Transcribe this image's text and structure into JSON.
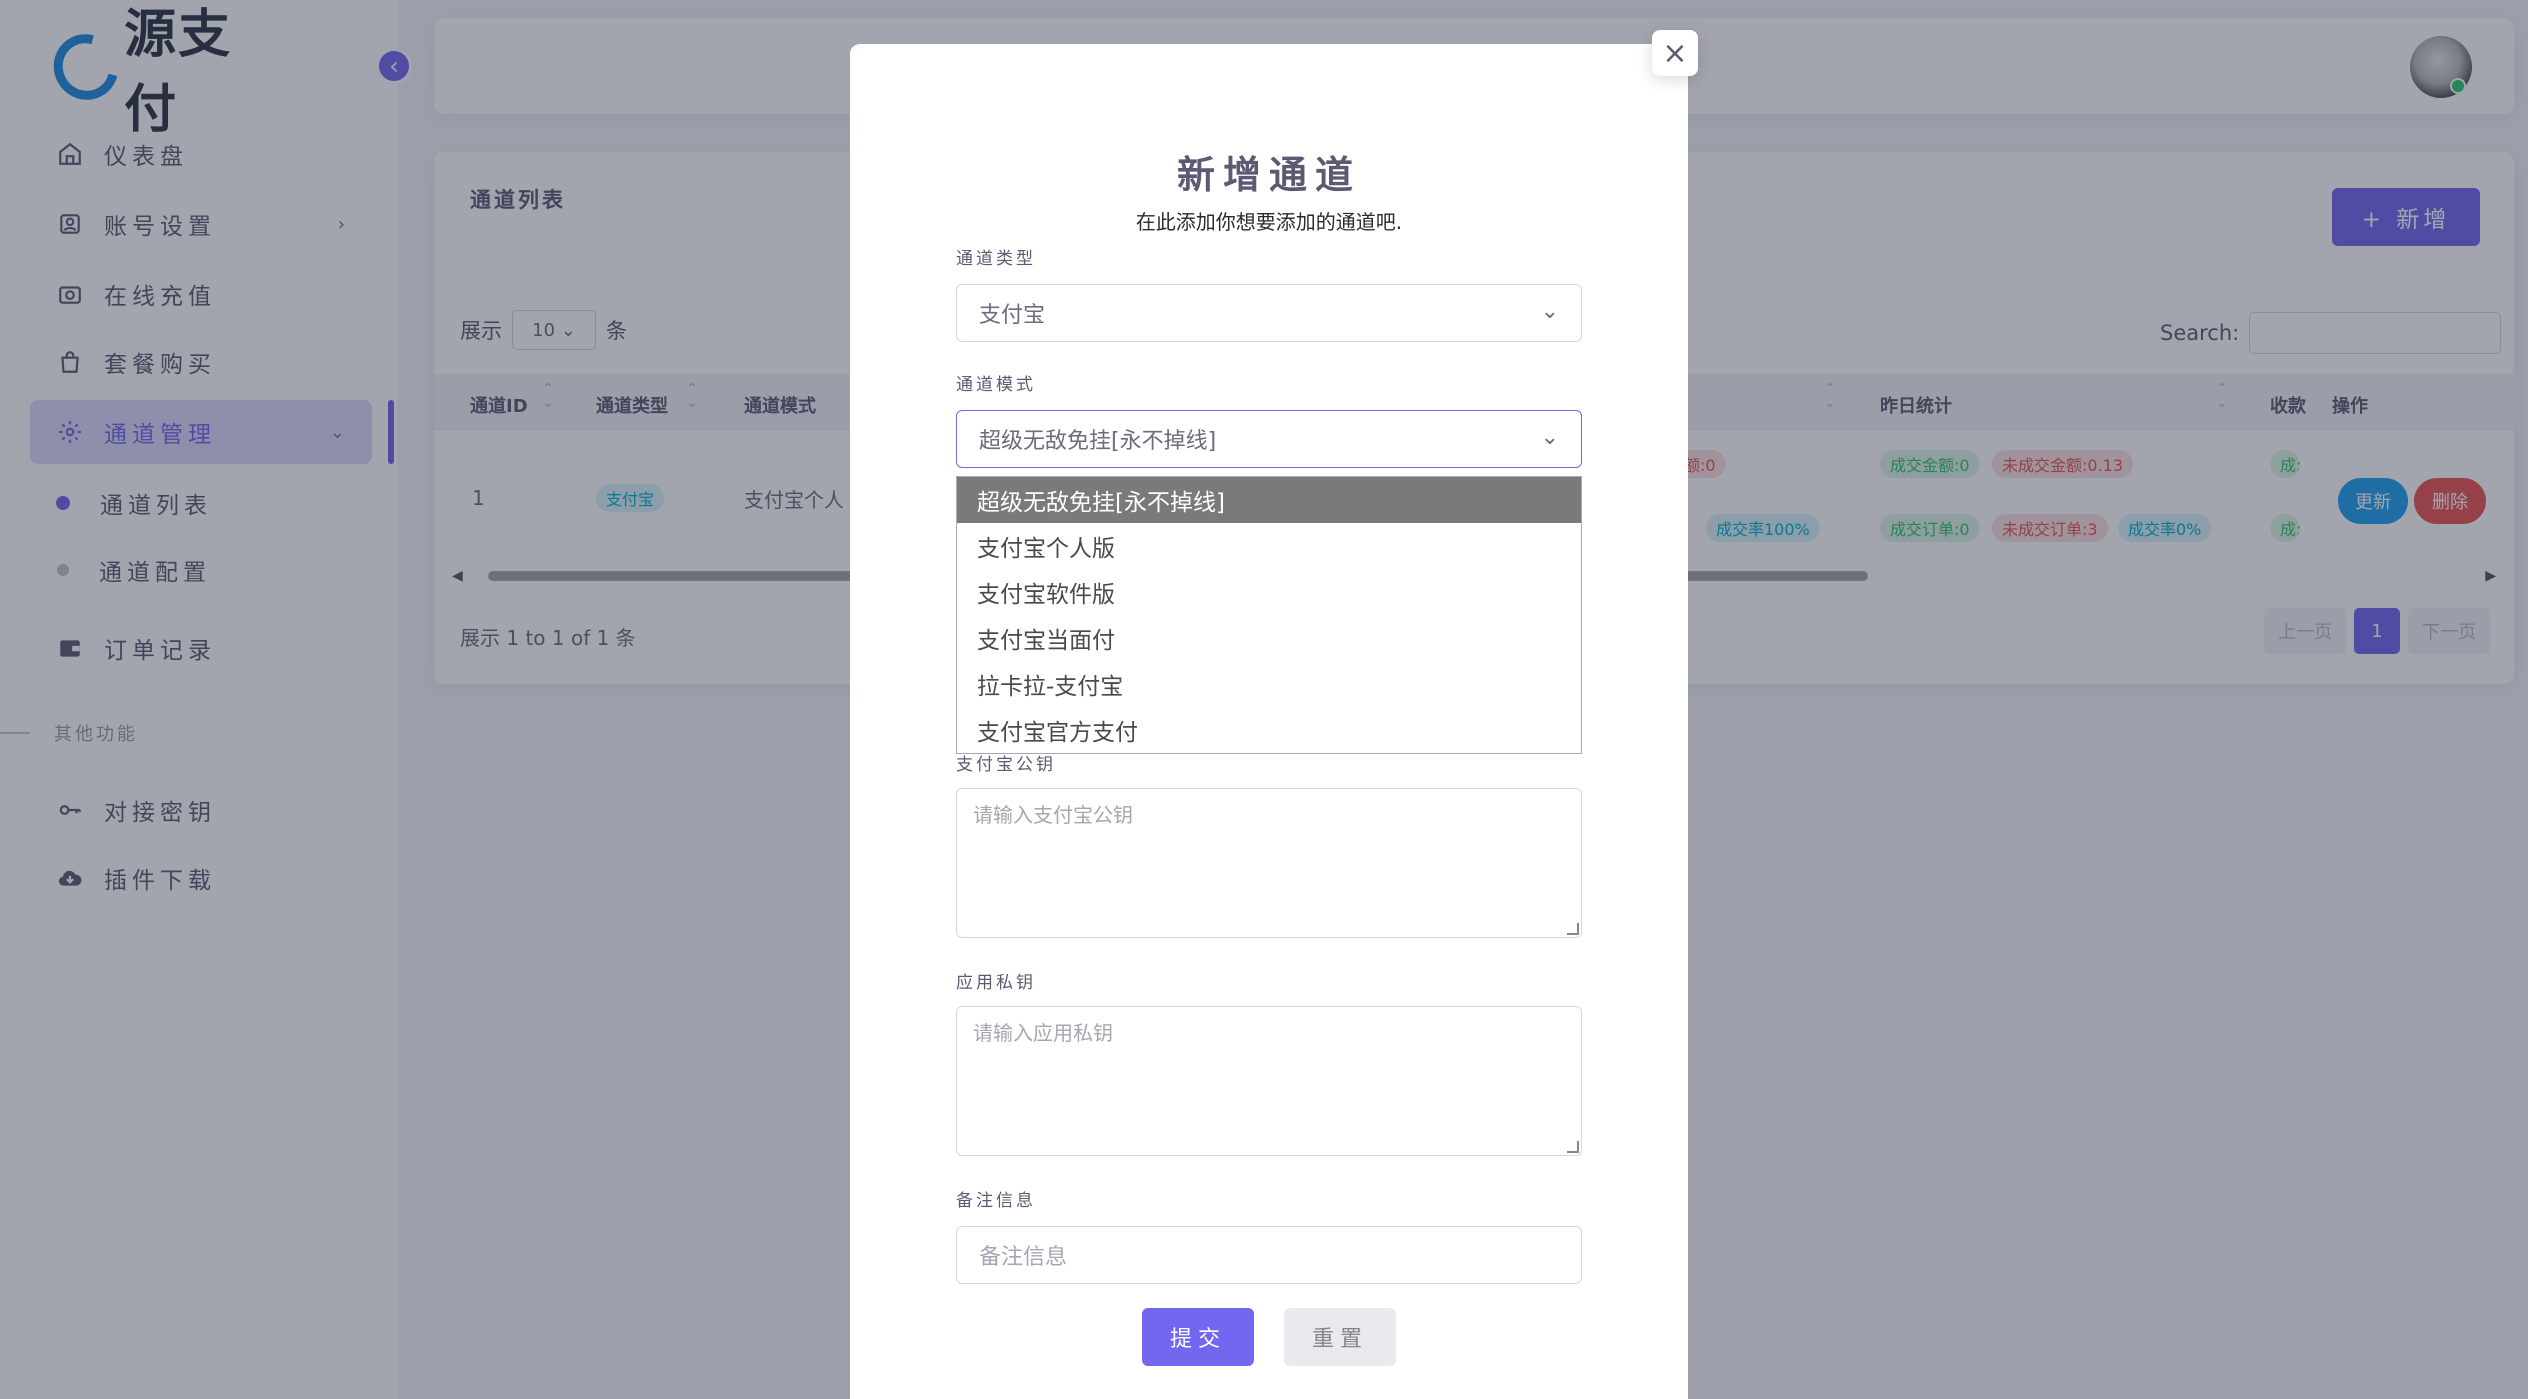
{
  "sidebar": {
    "logo_text": "源支付",
    "collapse_icon": "‹",
    "items": [
      {
        "label": "仪表盘",
        "icon": "home-icon"
      },
      {
        "label": "账号设置",
        "icon": "account-icon",
        "chevron": "›"
      },
      {
        "label": "在线充值",
        "icon": "camera-icon"
      },
      {
        "label": "套餐购买",
        "icon": "shopping-bag-icon"
      },
      {
        "label": "通道管理",
        "icon": "gear-icon",
        "chevron": "⌄"
      },
      {
        "label": "订单记录",
        "icon": "wallet-icon"
      }
    ],
    "sub_items": [
      {
        "label": "通道列表"
      },
      {
        "label": "通道配置"
      }
    ],
    "section_title": "其他功能",
    "extra_items": [
      {
        "label": "对接密钥",
        "icon": "key-icon"
      },
      {
        "label": "插件下载",
        "icon": "cloud-download-icon"
      }
    ]
  },
  "card": {
    "title": "通道列表",
    "add_button": "+ 新增",
    "show_prefix": "展示",
    "page_length": "10",
    "show_suffix": "条",
    "search_label": "Search:",
    "columns": [
      "通道ID",
      "通道类型",
      "通道模式",
      "昨日统计",
      "收款",
      "操作"
    ],
    "row": {
      "id": "1",
      "type_badge": "支付宝",
      "mode": "支付宝个人",
      "today_badges": [
        "额:0",
        "成交率100%"
      ],
      "yesterday_badges_1": [
        "成交金额:0",
        "未成交金额:0.13"
      ],
      "yesterday_badges_2": [
        "成交订单:0",
        "未成交订单:3",
        "成交率0%"
      ],
      "income_badges": [
        "成:",
        "成:"
      ],
      "update_btn": "更新",
      "delete_btn": "删除"
    },
    "info": "展示 1 to 1 of 1 条",
    "pager": {
      "prev": "上一页",
      "current": "1",
      "next": "下一页"
    }
  },
  "modal": {
    "title": "新增通道",
    "subtitle": "在此添加你想要添加的通道吧.",
    "channel_type_label": "通道类型",
    "channel_type_value": "支付宝",
    "channel_mode_label": "通道模式",
    "channel_mode_value": "超级无敌免挂[永不掉线]",
    "mode_options": [
      "超级无敌免挂[永不掉线]",
      "支付宝个人版",
      "支付宝软件版",
      "支付宝当面付",
      "拉卡拉-支付宝",
      "支付宝官方支付"
    ],
    "pubkey_label": "支付宝公钥",
    "pubkey_placeholder": "请输入支付宝公钥",
    "privkey_label": "应用私钥",
    "privkey_placeholder": "请输入应用私钥",
    "remark_label": "备注信息",
    "remark_placeholder": "备注信息",
    "submit": "提交",
    "reset": "重置",
    "close_icon": "×"
  },
  "colors": {
    "primary": "#7367f0",
    "success": "#28c76f",
    "danger": "#ea5455",
    "info": "#00cfe8"
  }
}
